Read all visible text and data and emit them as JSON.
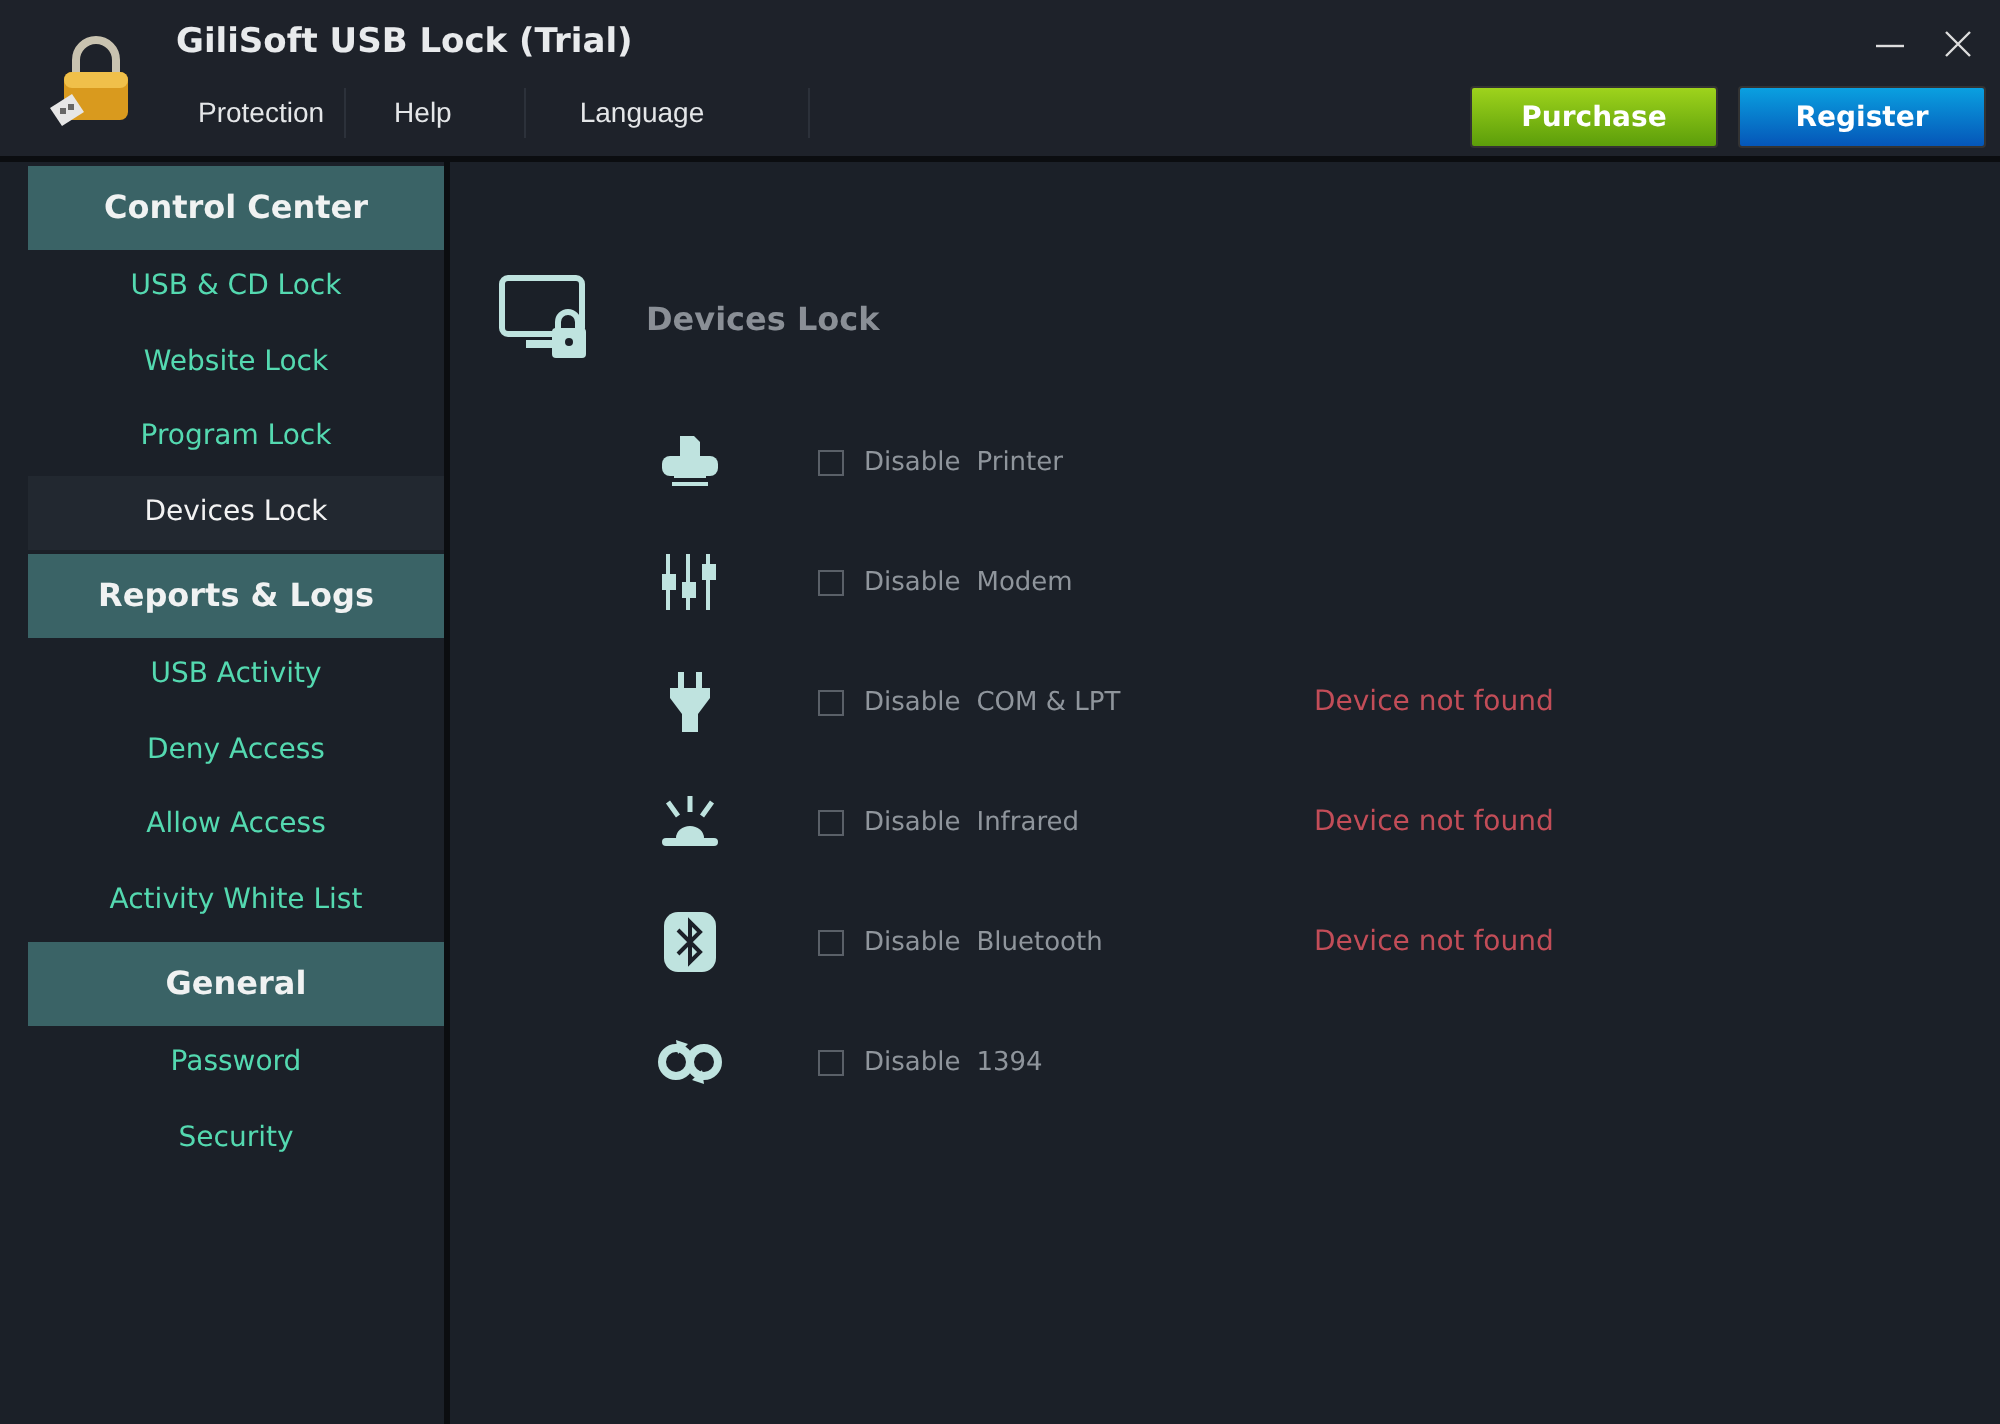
{
  "window": {
    "title": "GiliSoft USB Lock (Trial)"
  },
  "menu": [
    "Protection",
    "Help",
    "Language"
  ],
  "buttons": [
    {
      "label": "Purchase",
      "kind": "purchase"
    },
    {
      "label": "Register",
      "kind": "register"
    }
  ],
  "sidebar": {
    "sections": [
      {
        "title": "Control Center",
        "items": [
          {
            "label": "USB & CD Lock",
            "selected": false
          },
          {
            "label": "Website Lock",
            "selected": false
          },
          {
            "label": "Program Lock",
            "selected": false
          },
          {
            "label": "Devices Lock",
            "selected": true
          }
        ]
      },
      {
        "title": "Reports & Logs",
        "items": [
          {
            "label": "USB Activity",
            "selected": false
          },
          {
            "label": "Deny Access",
            "selected": false
          },
          {
            "label": "Allow Access",
            "selected": false
          },
          {
            "label": "Activity White List",
            "selected": false
          }
        ]
      },
      {
        "title": "General",
        "items": [
          {
            "label": "Password",
            "selected": false
          },
          {
            "label": "Security",
            "selected": false
          }
        ]
      }
    ]
  },
  "page": {
    "title": "Devices Lock",
    "devices": [
      {
        "kind": "printer",
        "action": "Disable",
        "device": "Printer",
        "checked": false
      },
      {
        "kind": "modem",
        "action": "Disable",
        "device": "Modem",
        "checked": false
      },
      {
        "kind": "plug",
        "action": "Disable",
        "device": "COM & LPT",
        "checked": false,
        "status": "Device not found"
      },
      {
        "kind": "infrared",
        "action": "Disable",
        "device": "Infrared",
        "checked": false,
        "status": "Device not found"
      },
      {
        "kind": "bluetooth",
        "action": "Disable",
        "device": "Bluetooth",
        "checked": false,
        "status": "Device not found"
      },
      {
        "kind": "firewire",
        "action": "Disable",
        "device": "1394",
        "checked": false
      }
    ]
  }
}
